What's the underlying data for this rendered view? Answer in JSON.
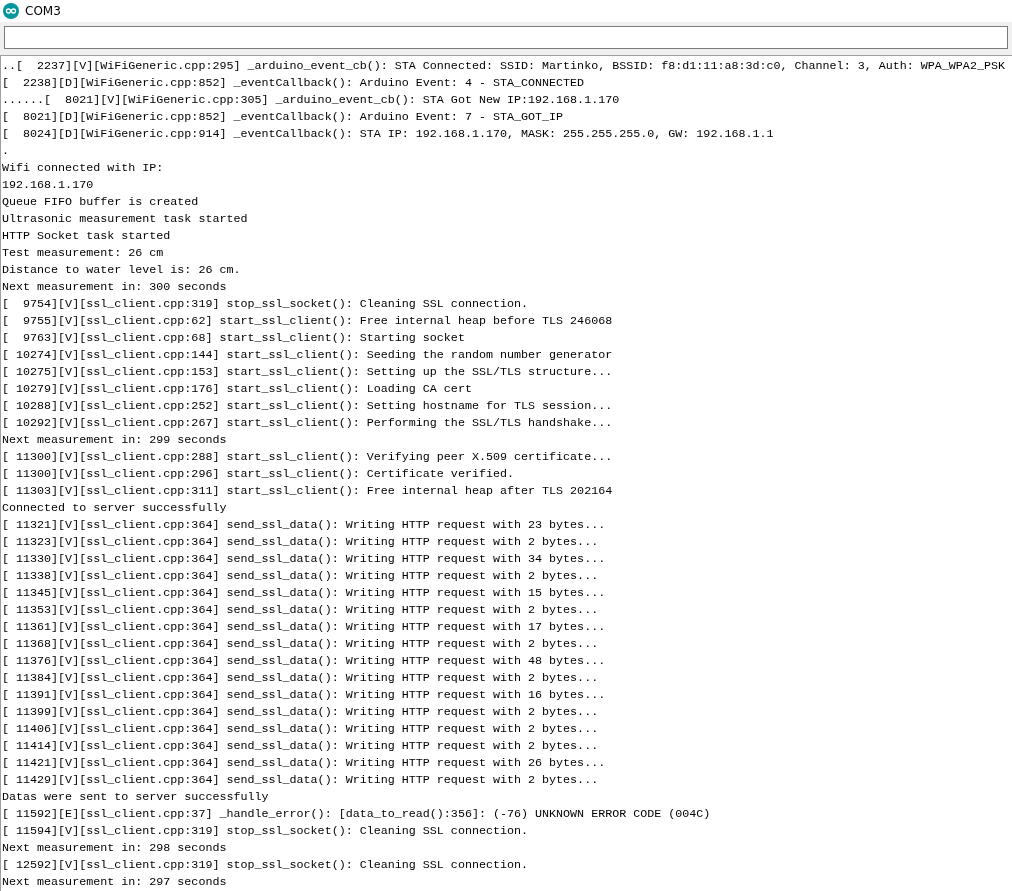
{
  "window": {
    "title": "COM3"
  },
  "output_lines": [
    "..[  2237][V][WiFiGeneric.cpp:295] _arduino_event_cb(): STA Connected: SSID: Martinko, BSSID: f8:d1:11:a8:3d:c0, Channel: 3, Auth: WPA_WPA2_PSK",
    "[  2238][D][WiFiGeneric.cpp:852] _eventCallback(): Arduino Event: 4 - STA_CONNECTED",
    "......[  8021][V][WiFiGeneric.cpp:305] _arduino_event_cb(): STA Got New IP:192.168.1.170",
    "[  8021][D][WiFiGeneric.cpp:852] _eventCallback(): Arduino Event: 7 - STA_GOT_IP",
    "[  8024][D][WiFiGeneric.cpp:914] _eventCallback(): STA IP: 192.168.1.170, MASK: 255.255.255.0, GW: 192.168.1.1",
    ".",
    "Wifi connected with IP:",
    "192.168.1.170",
    "Queue FIFO buffer is created",
    "Ultrasonic measurement task started",
    "HTTP Socket task started",
    "Test measurement: 26 cm",
    "Distance to water level is: 26 cm.",
    "Next measurement in: 300 seconds",
    "[  9754][V][ssl_client.cpp:319] stop_ssl_socket(): Cleaning SSL connection.",
    "[  9755][V][ssl_client.cpp:62] start_ssl_client(): Free internal heap before TLS 246068",
    "[  9763][V][ssl_client.cpp:68] start_ssl_client(): Starting socket",
    "[ 10274][V][ssl_client.cpp:144] start_ssl_client(): Seeding the random number generator",
    "[ 10275][V][ssl_client.cpp:153] start_ssl_client(): Setting up the SSL/TLS structure...",
    "[ 10279][V][ssl_client.cpp:176] start_ssl_client(): Loading CA cert",
    "[ 10288][V][ssl_client.cpp:252] start_ssl_client(): Setting hostname for TLS session...",
    "[ 10292][V][ssl_client.cpp:267] start_ssl_client(): Performing the SSL/TLS handshake...",
    "Next measurement in: 299 seconds",
    "[ 11300][V][ssl_client.cpp:288] start_ssl_client(): Verifying peer X.509 certificate...",
    "[ 11300][V][ssl_client.cpp:296] start_ssl_client(): Certificate verified.",
    "[ 11303][V][ssl_client.cpp:311] start_ssl_client(): Free internal heap after TLS 202164",
    "Connected to server successfully",
    "[ 11321][V][ssl_client.cpp:364] send_ssl_data(): Writing HTTP request with 23 bytes...",
    "[ 11323][V][ssl_client.cpp:364] send_ssl_data(): Writing HTTP request with 2 bytes...",
    "[ 11330][V][ssl_client.cpp:364] send_ssl_data(): Writing HTTP request with 34 bytes...",
    "[ 11338][V][ssl_client.cpp:364] send_ssl_data(): Writing HTTP request with 2 bytes...",
    "[ 11345][V][ssl_client.cpp:364] send_ssl_data(): Writing HTTP request with 15 bytes...",
    "[ 11353][V][ssl_client.cpp:364] send_ssl_data(): Writing HTTP request with 2 bytes...",
    "[ 11361][V][ssl_client.cpp:364] send_ssl_data(): Writing HTTP request with 17 bytes...",
    "[ 11368][V][ssl_client.cpp:364] send_ssl_data(): Writing HTTP request with 2 bytes...",
    "[ 11376][V][ssl_client.cpp:364] send_ssl_data(): Writing HTTP request with 48 bytes...",
    "[ 11384][V][ssl_client.cpp:364] send_ssl_data(): Writing HTTP request with 2 bytes...",
    "[ 11391][V][ssl_client.cpp:364] send_ssl_data(): Writing HTTP request with 16 bytes...",
    "[ 11399][V][ssl_client.cpp:364] send_ssl_data(): Writing HTTP request with 2 bytes...",
    "[ 11406][V][ssl_client.cpp:364] send_ssl_data(): Writing HTTP request with 2 bytes...",
    "[ 11414][V][ssl_client.cpp:364] send_ssl_data(): Writing HTTP request with 2 bytes...",
    "[ 11421][V][ssl_client.cpp:364] send_ssl_data(): Writing HTTP request with 26 bytes...",
    "[ 11429][V][ssl_client.cpp:364] send_ssl_data(): Writing HTTP request with 2 bytes...",
    "Datas were sent to server successfully",
    "[ 11592][E][ssl_client.cpp:37] _handle_error(): [data_to_read():356]: (-76) UNKNOWN ERROR CODE (004C)",
    "[ 11594][V][ssl_client.cpp:319] stop_ssl_socket(): Cleaning SSL connection.",
    "Next measurement in: 298 seconds",
    "[ 12592][V][ssl_client.cpp:319] stop_ssl_socket(): Cleaning SSL connection.",
    "Next measurement in: 297 seconds"
  ]
}
